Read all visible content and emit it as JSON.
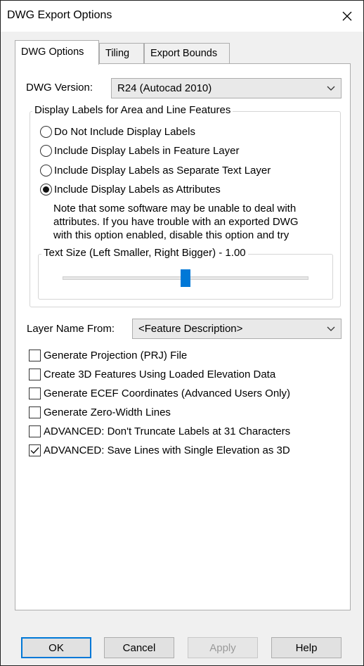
{
  "window": {
    "title": "DWG Export Options",
    "close_glyph": "✕"
  },
  "tabs": [
    {
      "label": "DWG Options",
      "active": true
    },
    {
      "label": "Tiling",
      "active": false
    },
    {
      "label": "Export Bounds",
      "active": false
    }
  ],
  "dwg_version": {
    "label": "DWG Version:",
    "value": "R24 (Autocad 2010)"
  },
  "display_labels": {
    "title": "Display Labels for Area and Line Features",
    "options": [
      {
        "label": "Do Not Include Display Labels",
        "checked": false
      },
      {
        "label": "Include Display Labels in Feature Layer",
        "checked": false
      },
      {
        "label": "Include Display Labels as Separate Text Layer",
        "checked": false
      },
      {
        "label": "Include Display Labels as Attributes",
        "checked": true
      }
    ],
    "note_lines": [
      "Note that some software may be unable to deal with",
      "attributes. If you have trouble with an exported DWG",
      "with this option enabled, disable this option and try"
    ],
    "text_size": {
      "title": "Text Size (Left Smaller, Right Bigger) - 1.00",
      "value": 1.0,
      "position": 0.5
    }
  },
  "layer_name": {
    "label": "Layer Name From:",
    "value": "<Feature Description>"
  },
  "checkboxes": [
    {
      "label": "Generate Projection (PRJ) File",
      "checked": false
    },
    {
      "label": "Create 3D Features Using Loaded Elevation Data",
      "checked": false
    },
    {
      "label": "Generate ECEF Coordinates (Advanced Users Only)",
      "checked": false
    },
    {
      "label": "Generate Zero-Width Lines",
      "checked": false
    },
    {
      "label": "ADVANCED: Don't Truncate Labels at 31 Characters",
      "checked": false
    },
    {
      "label": "ADVANCED: Save Lines with Single Elevation as 3D",
      "checked": true
    }
  ],
  "buttons": {
    "ok": "OK",
    "cancel": "Cancel",
    "apply": "Apply",
    "help": "Help"
  },
  "icons": {
    "close": "close-icon",
    "dropdown": "chevron-down-icon",
    "check": "checkmark-icon"
  },
  "colors": {
    "accent": "#0078d7",
    "face": "#f0f0f0",
    "disabled_text": "#9a9a9a"
  }
}
